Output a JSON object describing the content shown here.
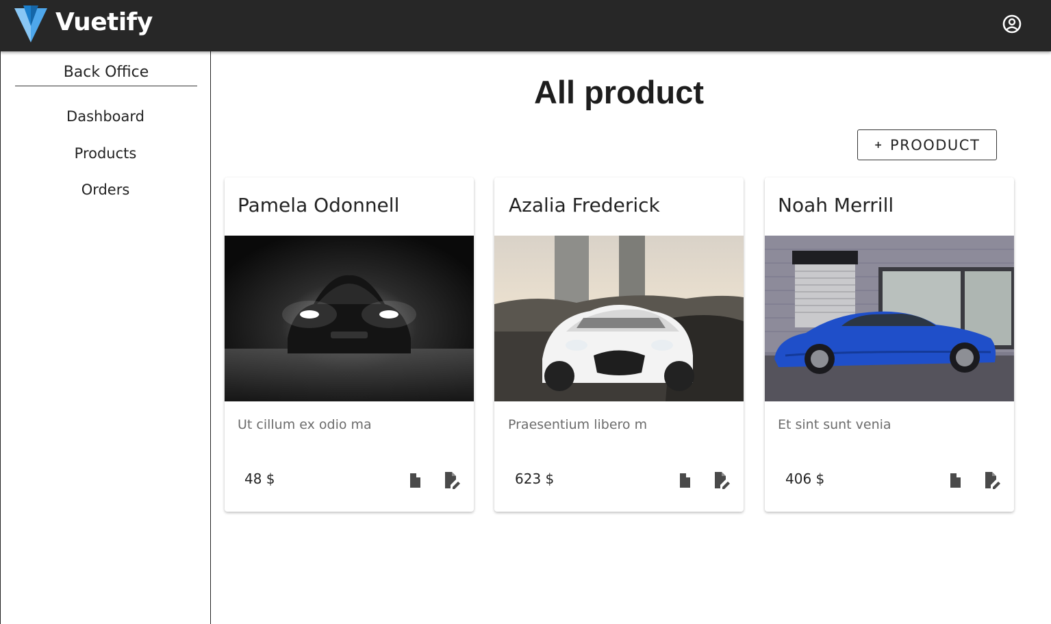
{
  "app_bar": {
    "brand": "Vuetify",
    "logo_icon": "vuetify-logo",
    "account_icon": "account-circle-icon"
  },
  "sidebar": {
    "title": "Back Office",
    "items": [
      {
        "label": "Dashboard"
      },
      {
        "label": "Products"
      },
      {
        "label": "Orders"
      }
    ]
  },
  "main": {
    "title": "All product",
    "add_button": {
      "icon": "plus-icon",
      "label": "PROODUCT"
    },
    "products": [
      {
        "name": "Pamela Odonnell",
        "description": "Ut cillum ex odio ma",
        "price": "48 $",
        "image": "dark-sports-car-headlights"
      },
      {
        "name": "Azalia Frederick",
        "description": "Praesentium libero m",
        "price": "623 $",
        "image": "white-sports-car-front"
      },
      {
        "name": "Noah Merrill",
        "description": "Et sint sunt venia",
        "price": "406 $",
        "image": "blue-coupe-side"
      }
    ]
  },
  "colors": {
    "app_bar": "#272727",
    "logo_light": "#89c7f5",
    "logo_dark": "#1b7fcc",
    "icon_grey": "#444444"
  }
}
